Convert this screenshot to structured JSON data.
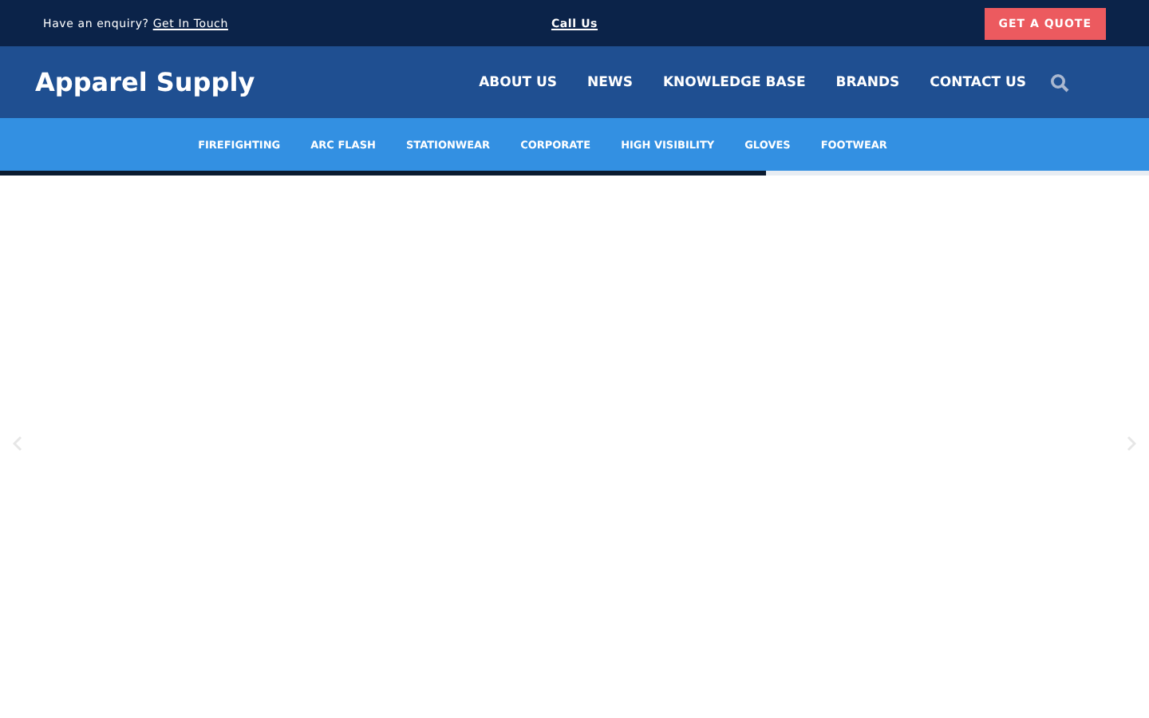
{
  "top_bar": {
    "enquiry": "Have an enquiry?",
    "enquiry_link": "Get In Touch",
    "call": "Call Us",
    "quote_button": "GET A QUOTE"
  },
  "header": {
    "logo": "Apparel Supply",
    "nav": [
      "ABOUT US",
      "NEWS",
      "KNOWLEDGE BASE",
      "BRANDS",
      "CONTACT US"
    ]
  },
  "categories": [
    "FIREFIGHTING",
    "ARC FLASH",
    "STATIONWEAR",
    "CORPORATE",
    "HIGH VISIBILITY",
    "GLOVES",
    "FOOTWEAR"
  ],
  "slider": {
    "level": 0.667
  }
}
